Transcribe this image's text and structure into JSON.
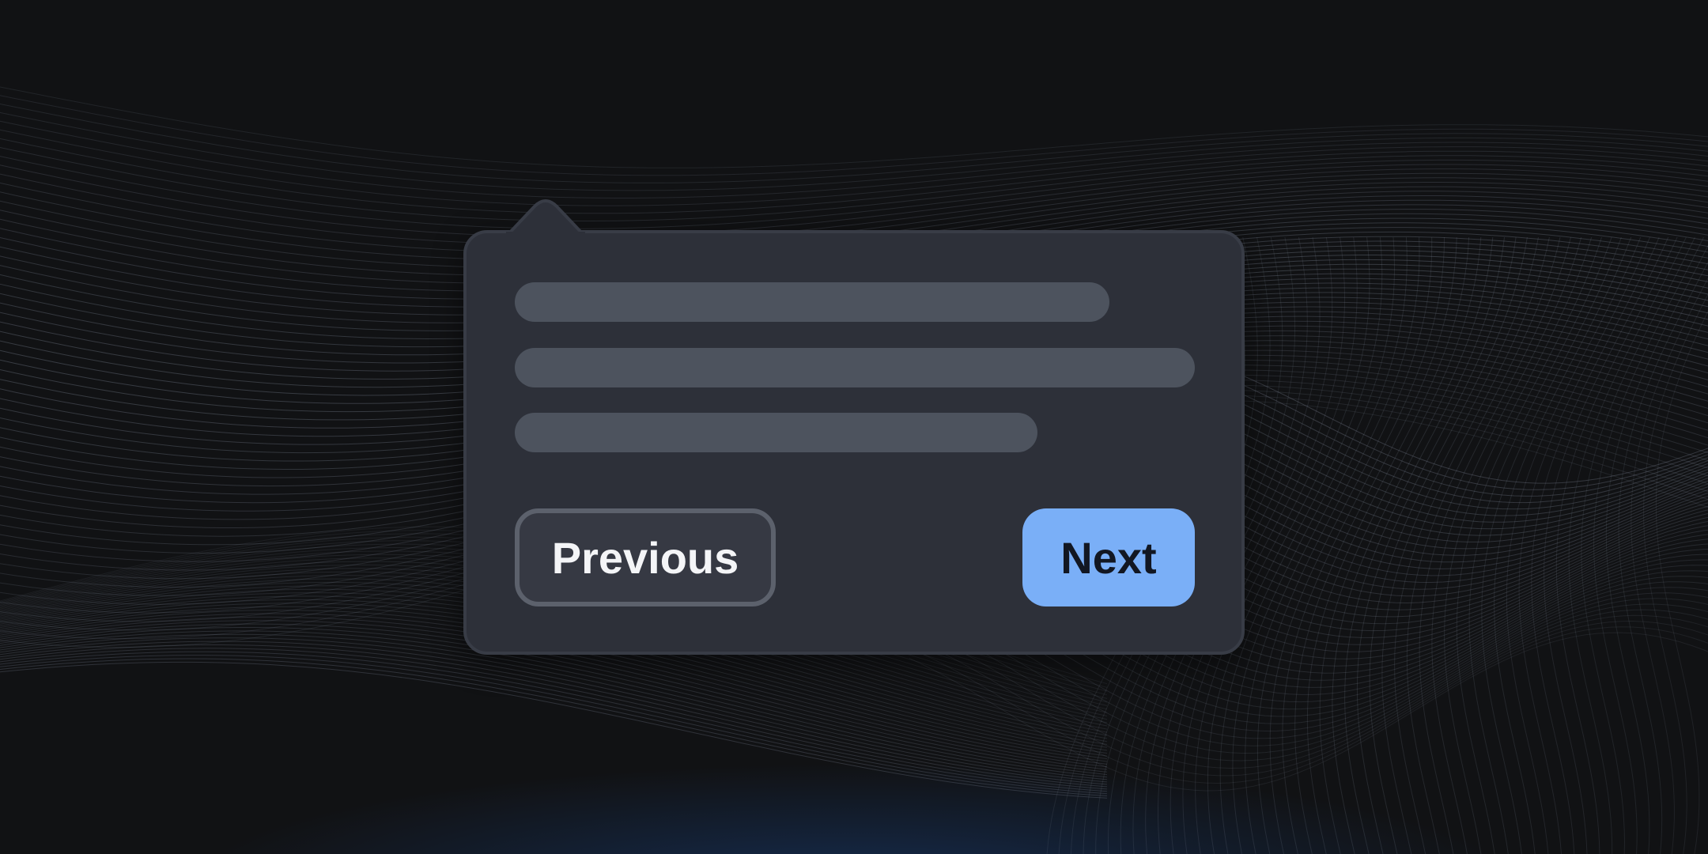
{
  "popover": {
    "skeleton_lines": 3
  },
  "buttons": {
    "previous_label": "Previous",
    "next_label": "Next"
  },
  "colors": {
    "background": "#111214",
    "popover_bg": "#2d3039",
    "skeleton": "#4d535e",
    "primary_button": "#7aaff7",
    "secondary_button_border": "#5c616c",
    "wave_lines": "#8a93a6"
  }
}
